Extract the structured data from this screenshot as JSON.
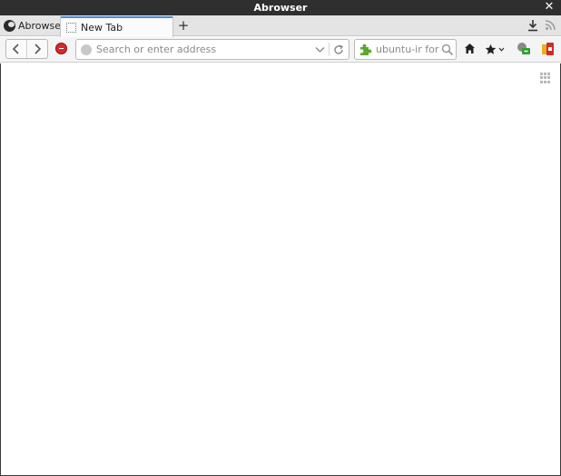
{
  "window": {
    "title": "Abrowser",
    "close_glyph": "✕"
  },
  "tabstrip": {
    "app_menu_label": "Abrowser",
    "tabs": [
      {
        "label": "New Tab",
        "active": true
      }
    ],
    "new_tab_glyph": "+"
  },
  "navbar": {
    "url_placeholder": "Search or enter address",
    "url_value": "",
    "search_placeholder": "ubuntu-ir forum",
    "search_value": ""
  },
  "icons": {
    "app_logo": "abrowser-logo-icon",
    "back": "chevron-left-icon",
    "forward": "chevron-right-icon",
    "addon": "addon-icon",
    "identity": "globe-icon",
    "dropmarker": "chevron-down-icon",
    "reload": "reload-icon",
    "search_engine": "puzzle-icon",
    "search_go": "magnifier-icon",
    "home": "home-icon",
    "bookmark": "star-icon",
    "downloads": "download-icon",
    "feed": "rss-icon",
    "grid": "grid-icon"
  },
  "colors": {
    "titlebar": "#2f2f2f",
    "tab_accent": "#4a90d9",
    "addon_red": "#d42a2a",
    "search_engine_green": "#5aa832"
  }
}
